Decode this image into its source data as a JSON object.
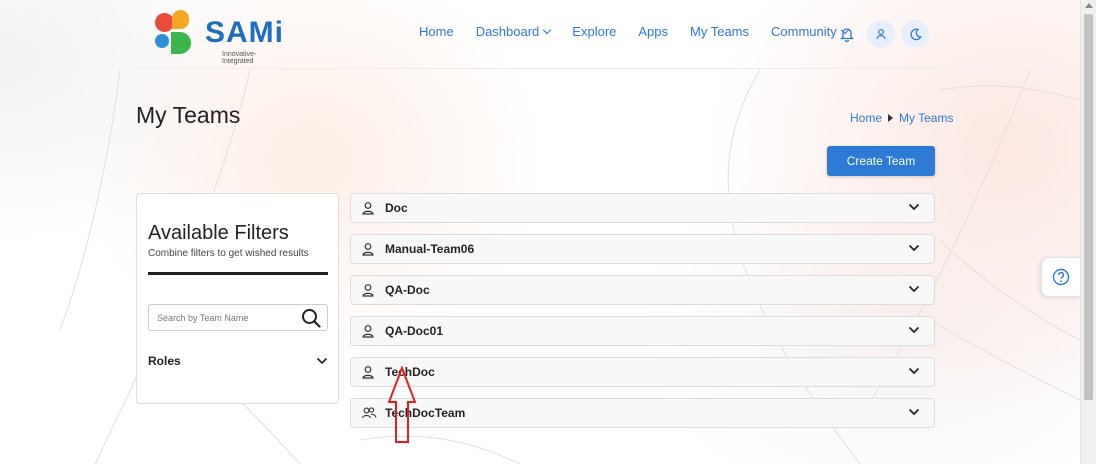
{
  "brand": {
    "name": "SAMi",
    "tagline": "Innovative-Integrated"
  },
  "nav": {
    "items": [
      "Home",
      "Dashboard",
      "Explore",
      "Apps",
      "My Teams",
      "Community"
    ],
    "notification_icon": "bell-icon",
    "user_icon": "user-icon",
    "theme_icon": "moon-icon"
  },
  "page": {
    "title": "My Teams",
    "breadcrumb": [
      "Home",
      "My Teams"
    ],
    "create_button": "Create Team"
  },
  "filters": {
    "title": "Available Filters",
    "subtitle": "Combine filters to get wished results",
    "search_placeholder": "Search by Team Name",
    "roles_label": "Roles"
  },
  "teams": [
    {
      "name": "Doc",
      "icon": "user-icon"
    },
    {
      "name": "Manual-Team06",
      "icon": "user-icon"
    },
    {
      "name": "QA-Doc",
      "icon": "user-icon"
    },
    {
      "name": "QA-Doc01",
      "icon": "user-icon"
    },
    {
      "name": "TechDoc",
      "icon": "user-icon"
    },
    {
      "name": "TechDocTeam",
      "icon": "users-icon"
    }
  ],
  "colors": {
    "accent": "#2d7ad6",
    "annotation_arrow": "#e02020"
  }
}
